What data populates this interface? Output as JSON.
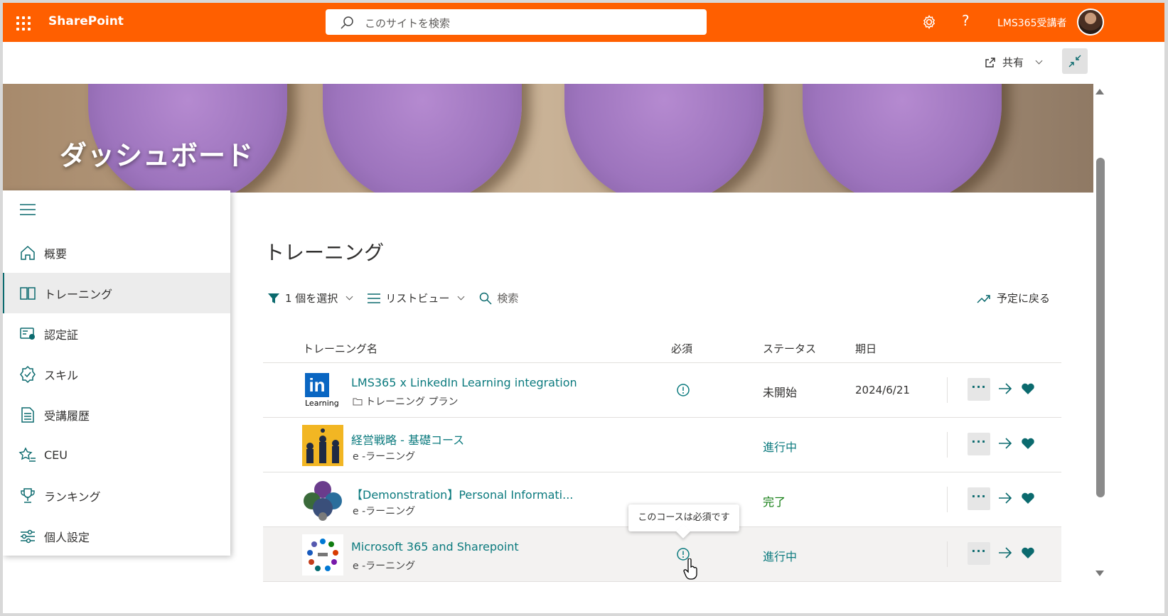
{
  "suitebar": {
    "brand": "SharePoint",
    "search_placeholder": "このサイトを検索",
    "user_name": "LMS365受講者",
    "help_glyph": "?",
    "color": "#ff5f00"
  },
  "commandbar": {
    "share_label": "共有"
  },
  "hero": {
    "title": "ダッシュボード"
  },
  "sidenav": {
    "items": [
      {
        "label": "概要",
        "icon": "home-icon"
      },
      {
        "label": "トレーニング",
        "icon": "book-icon",
        "active": true
      },
      {
        "label": "認定証",
        "icon": "certificate-icon"
      },
      {
        "label": "スキル",
        "icon": "badge-check-icon"
      },
      {
        "label": "受講履歴",
        "icon": "document-list-icon"
      },
      {
        "label": "CEU",
        "icon": "star-list-icon"
      },
      {
        "label": "ランキング",
        "icon": "trophy-icon"
      },
      {
        "label": "個人設定",
        "icon": "sliders-icon"
      }
    ]
  },
  "main": {
    "title": "トレーニング",
    "toolbar": {
      "filter_label": "1 個を選択",
      "view_label": "リストビュー",
      "search_label": "検索",
      "back_label": "予定に戻る"
    },
    "columns": {
      "name": "トレーニング名",
      "required": "必須",
      "status": "ステータス",
      "due": "期日"
    },
    "rows": [
      {
        "title": "LMS365 x LinkedIn Learning integration",
        "type": "トレーニング プラン",
        "required": true,
        "status": "未開始",
        "status_kind": "not-started",
        "due": "2024/6/21"
      },
      {
        "title": "経営戦略 - 基礎コース",
        "type": "e -ラーニング",
        "required": false,
        "status": "進行中",
        "status_kind": "in-progress",
        "due": ""
      },
      {
        "title": "【Demonstration】Personal Informati...",
        "type": "e -ラーニング",
        "required": false,
        "status": "完了",
        "status_kind": "done",
        "due": ""
      },
      {
        "title": "Microsoft 365 and Sharepoint",
        "type": "e -ラーニング",
        "required": true,
        "status": "進行中",
        "status_kind": "in-progress",
        "due": ""
      }
    ],
    "more_glyph": "···",
    "tooltip": "このコースは必須です",
    "linkedin_badge": "in",
    "linkedin_word": "Learning"
  },
  "colors": {
    "accent": "#0b7a7e",
    "done": "#107c10"
  }
}
